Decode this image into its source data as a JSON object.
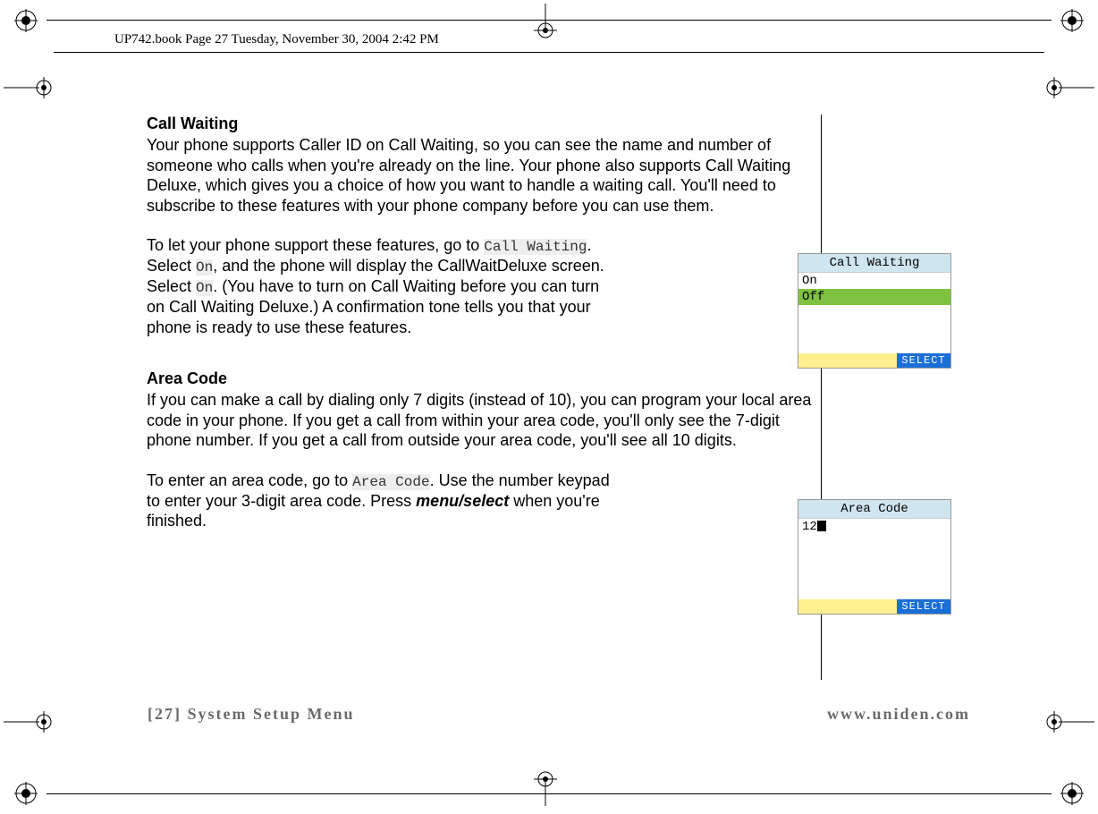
{
  "doc_header": "UP742.book  Page 27  Tuesday, November 30, 2004  2:42 PM",
  "section1": {
    "title": "Call Waiting",
    "para1": "Your phone supports Caller ID on Call Waiting, so you can see the name and number of someone who calls when you're already on the line. Your phone also supports Call Waiting Deluxe, which gives you a choice of how you want to handle a waiting call. You'll need to subscribe to these features with your phone company before you can use them.",
    "para2_pre": "To let your phone support these features, go to ",
    "cw_label": "Call Waiting",
    "para2_mid1": ". Select ",
    "on_label1": "On",
    "para2_mid2": ", and the phone will display the CallWaitDeluxe screen. Select ",
    "on_label2": "On",
    "para2_post": ". (You have to turn on Call Waiting before you can turn on Call Waiting Deluxe.) A confirmation tone tells you that your phone is ready to use these features."
  },
  "section2": {
    "title": "Area Code",
    "para1": "If you can make a call by dialing only 7 digits (instead of 10), you can program your local area code in your phone. If you get a call from within your area code, you'll only see the 7-digit phone number. If you get a call from outside your area code, you'll see all 10 digits.",
    "para2_pre": "To enter an area code, go to ",
    "ac_label": "Area Code",
    "para2_mid1": ". Use the number keypad to enter your 3-digit area code. Press ",
    "menu_select": "menu/select",
    "para2_post": " when you're finished."
  },
  "lcd1": {
    "title": "Call Waiting",
    "row1": "On",
    "row2": "Off",
    "softkey": "SELECT"
  },
  "lcd2": {
    "title": "Area Code",
    "value": "12",
    "softkey": "SELECT"
  },
  "footer": {
    "left": "[27] System Setup Menu",
    "right": "www.uniden.com"
  }
}
